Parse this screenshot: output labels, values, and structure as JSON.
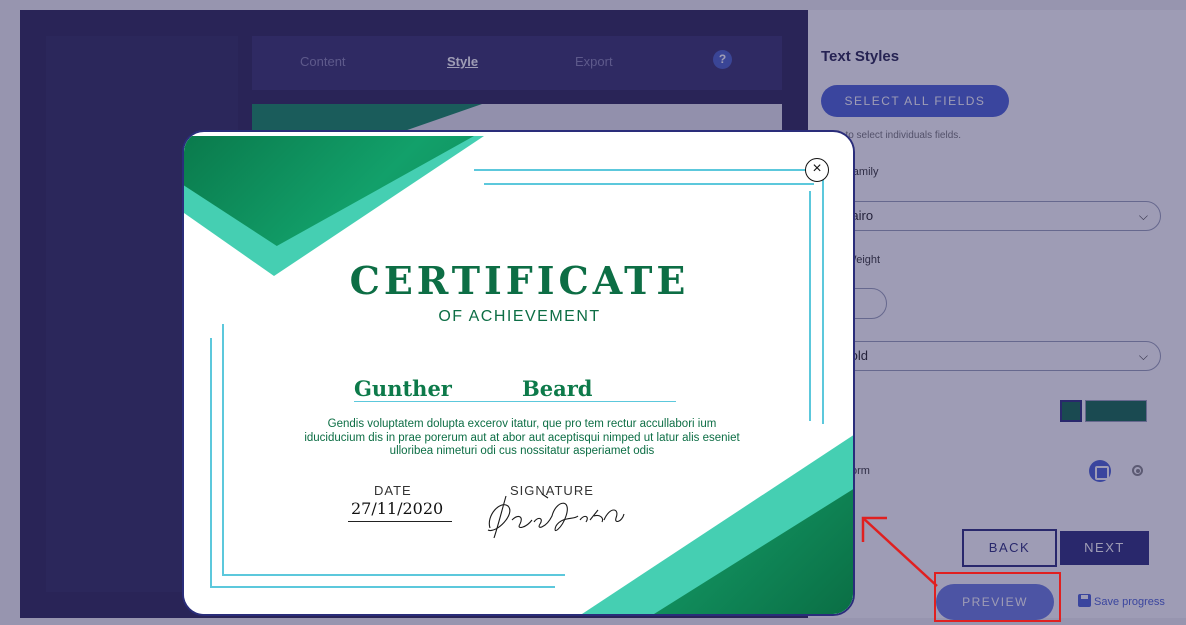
{
  "editor": {
    "tabs": [
      {
        "label": "Content"
      },
      {
        "label": "Style"
      },
      {
        "label": "Export"
      }
    ],
    "help_glyph": "?"
  },
  "text_styles": {
    "title": "Text Styles",
    "select_all_label": "SELECT ALL FIELDS",
    "select_hint": "Click to select individuals fields.",
    "font_family_label": "Font Family",
    "font_family_value": "Cairo",
    "font_weight_label": "Font Weight",
    "font_weight_value": "Bold",
    "text_form_label": "Text Form",
    "text_color": "#0f6b4a"
  },
  "navigation": {
    "back_label": "BACK",
    "next_label": "NEXT",
    "preview_label": "PREVIEW",
    "save_label": "Save progress"
  },
  "certificate": {
    "title": "CERTIFICATE",
    "subtitle": "OF ACHIEVEMENT",
    "first_name": "Gunther",
    "last_name": "Beard",
    "body": "Gendis voluptatem dolupta excerov itatur, que pro tem rectur accullabori ium iduciducium dis in prae porerum aut at abor aut aceptisqui nimped ut latur alis eseniet ulloribea nimeturi odi cus nossitatur asperiamet odis",
    "date_label": "DATE",
    "date_value": "27/11/2020",
    "signature_label": "SIGNATURE",
    "signature_text": "DocGenerator",
    "close_glyph": "×"
  },
  "colors": {
    "accent": "#4a62d6",
    "navy": "#2a2d7a",
    "cert_green": "#0d6e45",
    "cert_teal": "#45cfb2",
    "annotation_red": "#e02020"
  },
  "icons": [
    "help-icon",
    "chevron-down-icon",
    "save-icon",
    "close-icon"
  ]
}
